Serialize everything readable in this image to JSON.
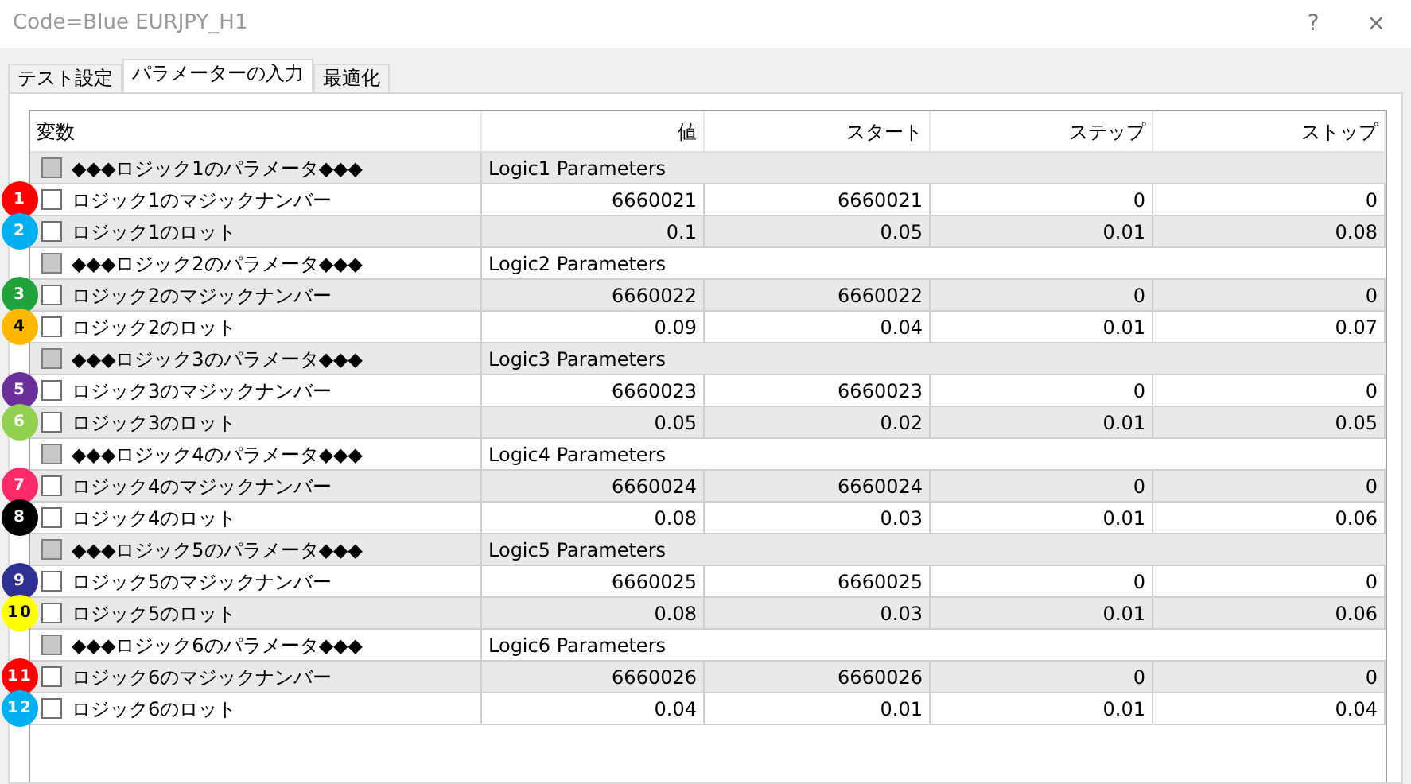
{
  "window": {
    "title": "Code=Blue EURJPY_H1",
    "help": "?",
    "close": "×"
  },
  "tabs": [
    {
      "label": "テスト設定",
      "selected": false
    },
    {
      "label": "パラメーターの入力",
      "selected": true
    },
    {
      "label": "最適化",
      "selected": false
    }
  ],
  "table": {
    "columns": [
      "変数",
      "値",
      "スタート",
      "ステップ",
      "ストップ"
    ],
    "rows": [
      {
        "kind": "group",
        "disabled": true,
        "name": "◆◆◆ロジック1のパラメータ◆◆◆",
        "comment": "Logic1 Parameters"
      },
      {
        "kind": "param",
        "disabled": false,
        "badge": "1",
        "color": "#ff0000",
        "name": "ロジック1のマジックナンバー",
        "value": "6660021",
        "start": "6660021",
        "step": "0",
        "stop": "0"
      },
      {
        "kind": "param",
        "disabled": false,
        "badge": "2",
        "color": "#00b0f0",
        "name": "ロジック1のロット",
        "value": "0.1",
        "start": "0.05",
        "step": "0.01",
        "stop": "0.08"
      },
      {
        "kind": "group",
        "disabled": true,
        "name": "◆◆◆ロジック2のパラメータ◆◆◆",
        "comment": "Logic2 Parameters"
      },
      {
        "kind": "param",
        "disabled": false,
        "badge": "3",
        "color": "#1fa33a",
        "name": "ロジック2のマジックナンバー",
        "value": "6660022",
        "start": "6660022",
        "step": "0",
        "stop": "0"
      },
      {
        "kind": "param",
        "disabled": false,
        "badge": "4",
        "color": "#ffb800",
        "name": "ロジック2のロット",
        "value": "0.09",
        "start": "0.04",
        "step": "0.01",
        "stop": "0.07"
      },
      {
        "kind": "group",
        "disabled": true,
        "name": "◆◆◆ロジック3のパラメータ◆◆◆",
        "comment": "Logic3 Parameters"
      },
      {
        "kind": "param",
        "disabled": false,
        "badge": "5",
        "color": "#6b2f9a",
        "name": "ロジック3のマジックナンバー",
        "value": "6660023",
        "start": "6660023",
        "step": "0",
        "stop": "0"
      },
      {
        "kind": "param",
        "disabled": false,
        "badge": "6",
        "color": "#92d050",
        "name": "ロジック3のロット",
        "value": "0.05",
        "start": "0.02",
        "step": "0.01",
        "stop": "0.05"
      },
      {
        "kind": "group",
        "disabled": true,
        "name": "◆◆◆ロジック4のパラメータ◆◆◆",
        "comment": "Logic4 Parameters"
      },
      {
        "kind": "param",
        "disabled": false,
        "badge": "7",
        "color": "#ff2a68",
        "name": "ロジック4のマジックナンバー",
        "value": "6660024",
        "start": "6660024",
        "step": "0",
        "stop": "0"
      },
      {
        "kind": "param",
        "disabled": false,
        "badge": "8",
        "color": "#000000",
        "name": "ロジック4のロット",
        "value": "0.08",
        "start": "0.03",
        "step": "0.01",
        "stop": "0.06"
      },
      {
        "kind": "group",
        "disabled": true,
        "name": "◆◆◆ロジック5のパラメータ◆◆◆",
        "comment": "Logic5 Parameters"
      },
      {
        "kind": "param",
        "disabled": false,
        "badge": "9",
        "color": "#2e3192",
        "name": "ロジック5のマジックナンバー",
        "value": "6660025",
        "start": "6660025",
        "step": "0",
        "stop": "0"
      },
      {
        "kind": "param",
        "disabled": false,
        "badge": "10",
        "color": "#ffff00",
        "name": "ロジック5のロット",
        "value": "0.08",
        "start": "0.03",
        "step": "0.01",
        "stop": "0.06"
      },
      {
        "kind": "group",
        "disabled": true,
        "name": "◆◆◆ロジック6のパラメータ◆◆◆",
        "comment": "Logic6 Parameters"
      },
      {
        "kind": "param",
        "disabled": false,
        "badge": "11",
        "color": "#ff0000",
        "name": "ロジック6のマジックナンバー",
        "value": "6660026",
        "start": "6660026",
        "step": "0",
        "stop": "0"
      },
      {
        "kind": "param",
        "disabled": false,
        "badge": "12",
        "color": "#00b0f0",
        "name": "ロジック6のロット",
        "value": "0.04",
        "start": "0.01",
        "step": "0.01",
        "stop": "0.04"
      }
    ]
  }
}
